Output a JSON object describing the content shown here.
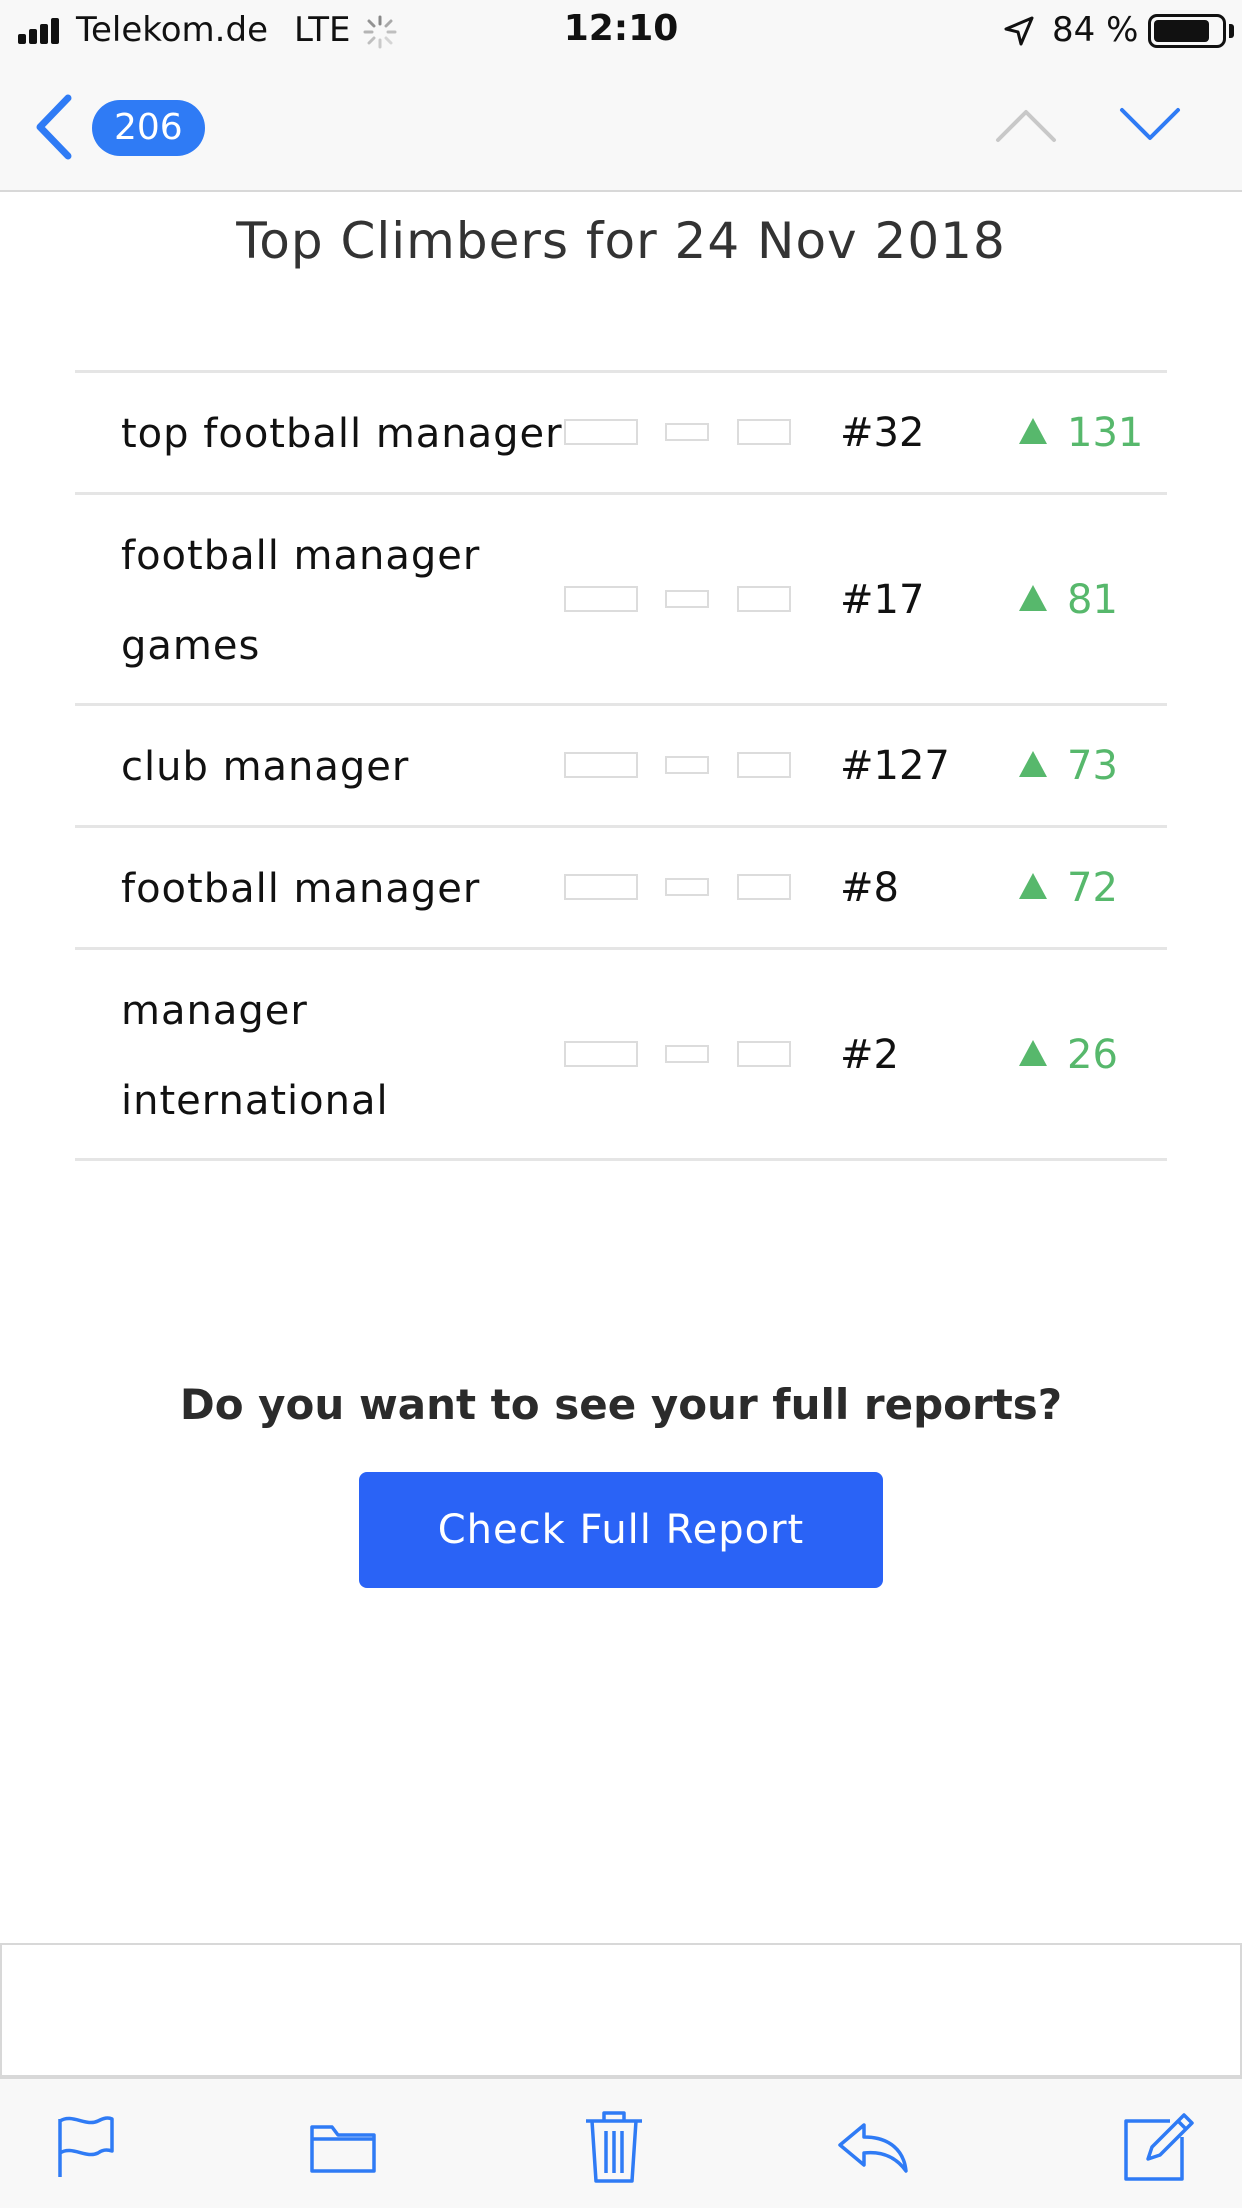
{
  "status_bar": {
    "carrier": "Telekom.de",
    "network": "LTE",
    "time": "12:10",
    "battery_percent": "84 %",
    "battery_level": 0.84,
    "icons": [
      "signal-icon",
      "loading-spinner-icon",
      "location-arrow-icon",
      "battery-icon"
    ]
  },
  "nav": {
    "back_icon": "chevron-left-icon",
    "unread_count": "206",
    "prev_icon": "chevron-up-icon",
    "next_icon": "chevron-down-icon"
  },
  "email": {
    "title": "Top Climbers for 24 Nov 2018",
    "rows": [
      {
        "keyword": "top football manager",
        "rank": "#32",
        "change": "131"
      },
      {
        "keyword": "football manager games",
        "rank": "#17",
        "change": "81"
      },
      {
        "keyword": "club manager",
        "rank": "#127",
        "change": "73"
      },
      {
        "keyword": "football manager",
        "rank": "#8",
        "change": "72"
      },
      {
        "keyword": "manager international",
        "rank": "#2",
        "change": "26"
      }
    ],
    "cta_question": "Do you want to see your full reports?",
    "cta_button": "Check Full Report"
  },
  "toolbar": {
    "icons": [
      "flag-icon",
      "folder-icon",
      "trash-icon",
      "reply-icon",
      "compose-icon"
    ]
  },
  "colors": {
    "accent": "#2f7bf5",
    "button": "#2a63f6",
    "positive": "#57b86c"
  }
}
